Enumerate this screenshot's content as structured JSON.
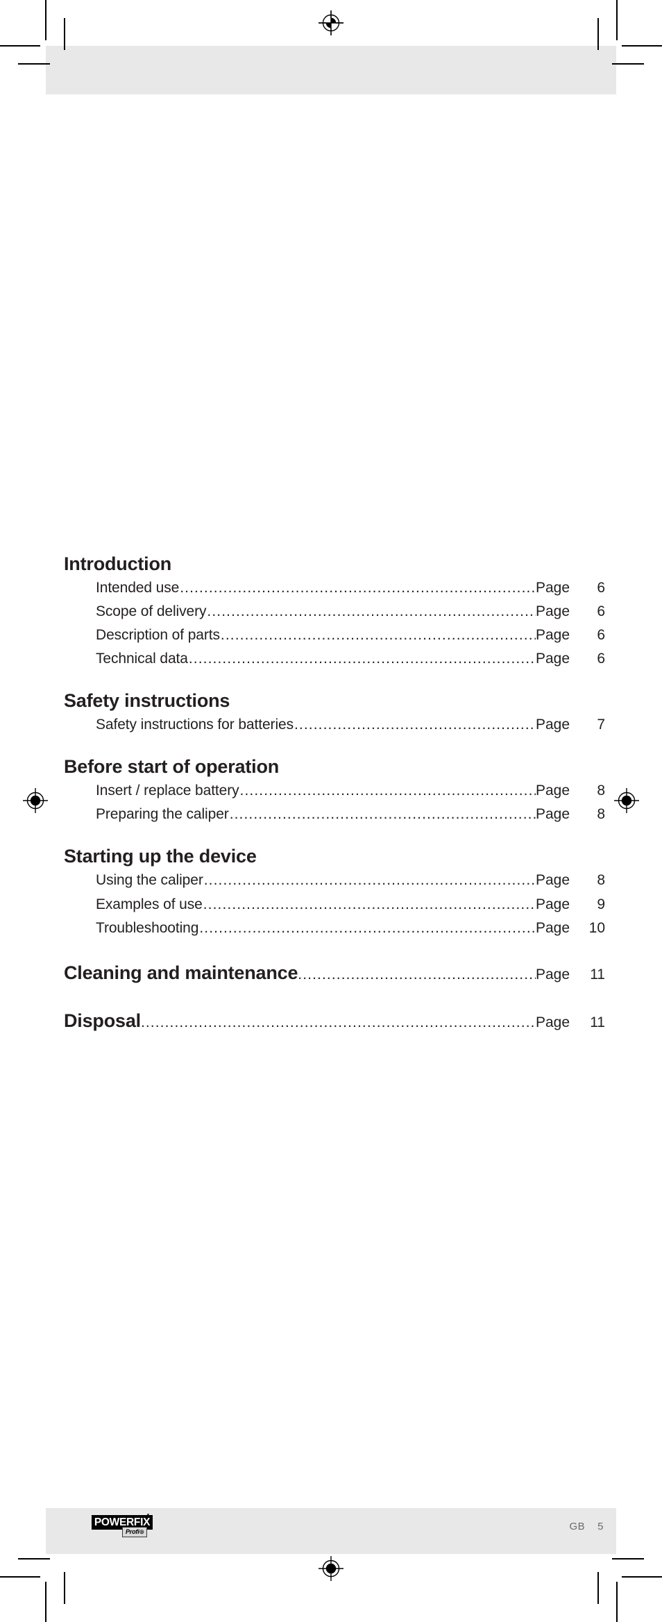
{
  "document": {
    "type": "table-of-contents",
    "language_code": "GB",
    "page_number": "5"
  },
  "toc": {
    "page_label": "Page",
    "groups": [
      {
        "heading": "Introduction",
        "heading_has_page": false,
        "entries": [
          {
            "title": "Intended use",
            "page_label": "Page",
            "page": "6"
          },
          {
            "title": "Scope of delivery ",
            "page_label": "Page",
            "page": "6"
          },
          {
            "title": "Description of parts ",
            "page_label": "Page",
            "page": "6"
          },
          {
            "title": "Technical data",
            "page_label": "Page",
            "page": "6"
          }
        ]
      },
      {
        "heading": "Safety instructions",
        "heading_has_page": false,
        "entries": [
          {
            "title": "Safety instructions for batteries ",
            "page_label": "Page",
            "page": "7"
          }
        ]
      },
      {
        "heading": "Before start of operation",
        "heading_has_page": false,
        "entries": [
          {
            "title": "Insert / replace battery",
            "page_label": "Page",
            "page": "8"
          },
          {
            "title": "Preparing the caliper",
            "page_label": "Page",
            "page": "8"
          }
        ]
      },
      {
        "heading": "Starting up the device",
        "heading_has_page": false,
        "entries": [
          {
            "title": "Using the caliper",
            "page_label": "Page",
            "page": "8"
          },
          {
            "title": "Examples of use",
            "page_label": "Page",
            "page": "9"
          },
          {
            "title": "Troubleshooting ",
            "page_label": "Page",
            "page": "10"
          }
        ]
      },
      {
        "heading": "Cleaning and maintenance ",
        "heading_has_page": true,
        "heading_page_label": "Page",
        "heading_page": "11",
        "entries": []
      },
      {
        "heading": "Disposal",
        "heading_has_page": true,
        "heading_page_label": "Page",
        "heading_page": "11",
        "entries": []
      }
    ]
  },
  "footer": {
    "brand": "POWERFIX",
    "brand_sub": "Profi",
    "brand_sub_mark": "⊕",
    "language_code": "GB",
    "page_number": "5"
  },
  "colors": {
    "band": "#e8e8e8",
    "text": "#231f20",
    "footer_text": "#6b6b6b",
    "logo_bg": "#000000",
    "logo_fg": "#ffffff"
  },
  "print_marks": {
    "registration_mark_count": 4,
    "crop_mark_sets": 2
  }
}
